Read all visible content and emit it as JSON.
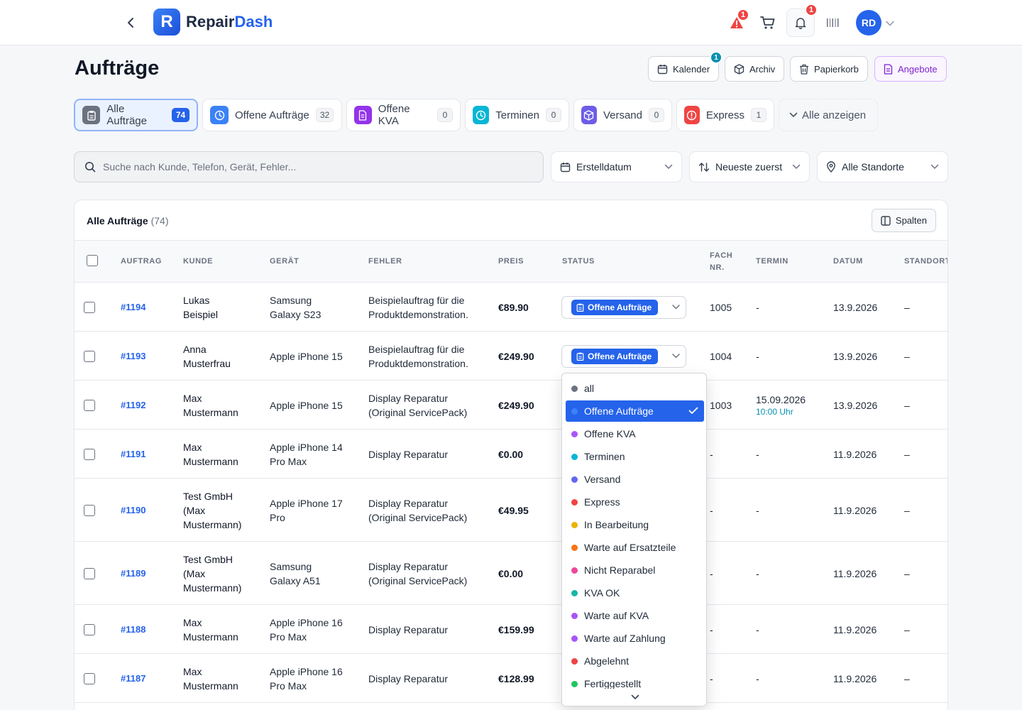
{
  "brand": {
    "name_part1": "Repair",
    "name_part2": "Dash",
    "logo_letter": "R"
  },
  "header": {
    "alert_badge": "1",
    "notification_badge": "1",
    "avatar_initials": "RD"
  },
  "page": {
    "title": "Aufträge"
  },
  "top_buttons": {
    "calendar": {
      "label": "Kalender",
      "badge": "1"
    },
    "archive": {
      "label": "Archiv"
    },
    "trash": {
      "label": "Papierkorb"
    },
    "offers": {
      "label": "Angebote"
    }
  },
  "filter_tabs": [
    {
      "label": "Alle Aufträge",
      "count": "74",
      "active": true,
      "color": "#6b7280"
    },
    {
      "label": "Offene Aufträge",
      "count": "32",
      "color": "#3b82f6"
    },
    {
      "label": "Offene KVA",
      "count": "0",
      "color": "#9333ea"
    },
    {
      "label": "Terminen",
      "count": "0",
      "color": "#06b6d4"
    },
    {
      "label": "Versand",
      "count": "0",
      "color": "#6d5ce8"
    },
    {
      "label": "Express",
      "count": "1",
      "color": "#ef4444"
    }
  ],
  "show_all_label": "Alle anzeigen",
  "search": {
    "placeholder": "Suche nach Kunde, Telefon, Gerät, Fehler..."
  },
  "selects": {
    "date": "Erstelldatum",
    "sort": "Neueste zuerst",
    "location": "Alle Standorte"
  },
  "card": {
    "title": "Alle Aufträge",
    "count": "(74)",
    "columns_button": "Spalten"
  },
  "table": {
    "headers": {
      "order": "Auftrag",
      "customer": "Kunde",
      "device": "Gerät",
      "fault": "Fehler",
      "price": "Preis",
      "status": "Status",
      "fach_line1": "Fach",
      "fach_line2": "Nr.",
      "termin": "Termin",
      "date": "Datum",
      "location": "Standort"
    },
    "rows": [
      {
        "id": "#1194",
        "customer": [
          "Lukas",
          "Beispiel"
        ],
        "device": [
          "Samsung",
          "Galaxy S23"
        ],
        "fault": [
          "Beispielauftrag für die",
          "Produktdemonstration."
        ],
        "price": "€89.90",
        "status": "Offene Aufträge",
        "fach": "1005",
        "termin": "-",
        "termin_time": "",
        "date": "13.9.2026",
        "location": "–"
      },
      {
        "id": "#1193",
        "customer": [
          "Anna",
          "Musterfrau"
        ],
        "device": [
          "Apple iPhone 15"
        ],
        "fault": [
          "Beispielauftrag für die",
          "Produktdemonstration."
        ],
        "price": "€249.90",
        "status": "Offene Aufträge",
        "fach": "1004",
        "termin": "-",
        "termin_time": "",
        "date": "13.9.2026",
        "location": "–"
      },
      {
        "id": "#1192",
        "customer": [
          "Max",
          "Mustermann"
        ],
        "device": [
          "Apple iPhone 15"
        ],
        "fault": [
          "Display Reparatur",
          "(Original ServicePack)"
        ],
        "price": "€249.90",
        "status": "",
        "fach": "1003",
        "termin": "15.09.2026",
        "termin_time": "10:00 Uhr",
        "date": "13.9.2026",
        "location": "–"
      },
      {
        "id": "#1191",
        "customer": [
          "Max",
          "Mustermann"
        ],
        "device": [
          "Apple iPhone 14",
          "Pro Max"
        ],
        "fault": [
          "Display Reparatur"
        ],
        "price": "€0.00",
        "status": "",
        "fach": "-",
        "termin": "-",
        "termin_time": "",
        "date": "11.9.2026",
        "location": "–"
      },
      {
        "id": "#1190",
        "customer": [
          "Test GmbH",
          "(Max",
          "Mustermann)"
        ],
        "device": [
          "Apple iPhone 17",
          "Pro"
        ],
        "fault": [
          "Display Reparatur",
          "(Original ServicePack)"
        ],
        "price": "€49.95",
        "status": "",
        "fach": "-",
        "termin": "-",
        "termin_time": "",
        "date": "11.9.2026",
        "location": "–"
      },
      {
        "id": "#1189",
        "customer": [
          "Test GmbH",
          "(Max",
          "Mustermann)"
        ],
        "device": [
          "Samsung",
          "Galaxy A51"
        ],
        "fault": [
          "Display Reparatur",
          "(Original ServicePack)"
        ],
        "price": "€0.00",
        "status": "",
        "fach": "-",
        "termin": "-",
        "termin_time": "",
        "date": "11.9.2026",
        "location": "–"
      },
      {
        "id": "#1188",
        "customer": [
          "Max",
          "Mustermann"
        ],
        "device": [
          "Apple iPhone 16",
          "Pro Max"
        ],
        "fault": [
          "Display Reparatur"
        ],
        "price": "€159.99",
        "status": "",
        "fach": "-",
        "termin": "-",
        "termin_time": "",
        "date": "11.9.2026",
        "location": "–"
      },
      {
        "id": "#1187",
        "customer": [
          "Max",
          "Mustermann"
        ],
        "device": [
          "Apple iPhone 16",
          "Pro Max"
        ],
        "fault": [
          "Display Reparatur"
        ],
        "price": "€128.99",
        "status": "",
        "fach": "-",
        "termin": "-",
        "termin_time": "",
        "date": "11.9.2026",
        "location": "–"
      }
    ]
  },
  "status_dropdown": {
    "selected": "Offene Aufträge",
    "options": [
      {
        "label": "all",
        "color": "#6b7280"
      },
      {
        "label": "Offene Aufträge",
        "color": "#3b82f6"
      },
      {
        "label": "Offene KVA",
        "color": "#a855f7"
      },
      {
        "label": "Terminen",
        "color": "#06b6d4"
      },
      {
        "label": "Versand",
        "color": "#6366f1"
      },
      {
        "label": "Express",
        "color": "#ef4444"
      },
      {
        "label": "In Bearbeitung",
        "color": "#eab308"
      },
      {
        "label": "Warte auf Ersatzteile",
        "color": "#f97316"
      },
      {
        "label": "Nicht Reparabel",
        "color": "#ec4899"
      },
      {
        "label": "KVA OK",
        "color": "#14b8a6"
      },
      {
        "label": "Warte auf KVA",
        "color": "#a855f7"
      },
      {
        "label": "Warte auf Zahlung",
        "color": "#a855f7"
      },
      {
        "label": "Abgelehnt",
        "color": "#ef4444"
      },
      {
        "label": "Fertiggestellt",
        "color": "#22c55e"
      }
    ]
  }
}
